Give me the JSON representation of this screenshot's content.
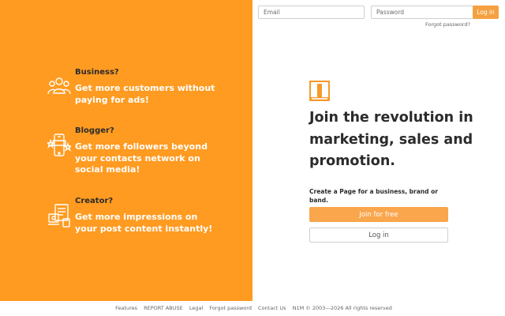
{
  "login": {
    "email_placeholder": "Email",
    "password_placeholder": "Password",
    "login_label": "Log in",
    "forgot_label": "Forgot password?"
  },
  "features": [
    {
      "title": "Business?",
      "desc": "Get more customers without paying for ads!",
      "icon": "people-group-icon"
    },
    {
      "title": "Blogger?",
      "desc": "Get more followers beyond your contacts network on social media!",
      "icon": "smartphone-stars-icon"
    },
    {
      "title": "Creator?",
      "desc": "Get more impressions on your post content instantly!",
      "icon": "creator-devices-icon"
    }
  ],
  "hero": {
    "logo_icon": "n1m-logo-icon",
    "headline": "Join the revolution in marketing, sales and promotion.",
    "create_text": "Create a Page for a business, brand or band.",
    "join_label": "Join for free",
    "login_label": "Log in"
  },
  "footer": {
    "links": [
      "Features",
      "REPORT ABUSE",
      "Legal",
      "Forgot password",
      "Contact Us"
    ],
    "copyright": "N1M © 2003—2026 All rights reserved"
  },
  "colors": {
    "accent": "#ff9b21",
    "button": "#f9a64c"
  }
}
